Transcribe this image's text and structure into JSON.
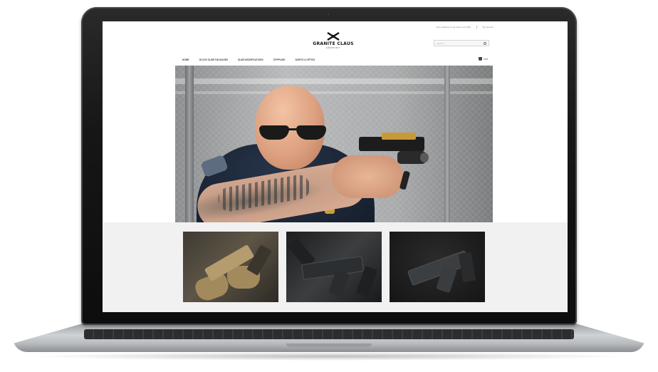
{
  "site": {
    "topbar": [
      "Free shipping on all orders over $99",
      "My account"
    ],
    "logo_text": "GRANITE CLAUS",
    "logo_sub": "ARMORY",
    "search_placeholder": "Search...",
    "nav": [
      "Home",
      "Glock Slide Packages",
      "Slide Modifications",
      "Stippling",
      "Sights & Optics"
    ],
    "cart_label": "Cart"
  },
  "hero": {
    "alt": ""
  },
  "products": [
    {
      "id": "p1"
    },
    {
      "id": "p2"
    },
    {
      "id": "p3"
    }
  ],
  "colors": {
    "accent": "#c9a13a",
    "laptop_bezel": "#161616"
  }
}
